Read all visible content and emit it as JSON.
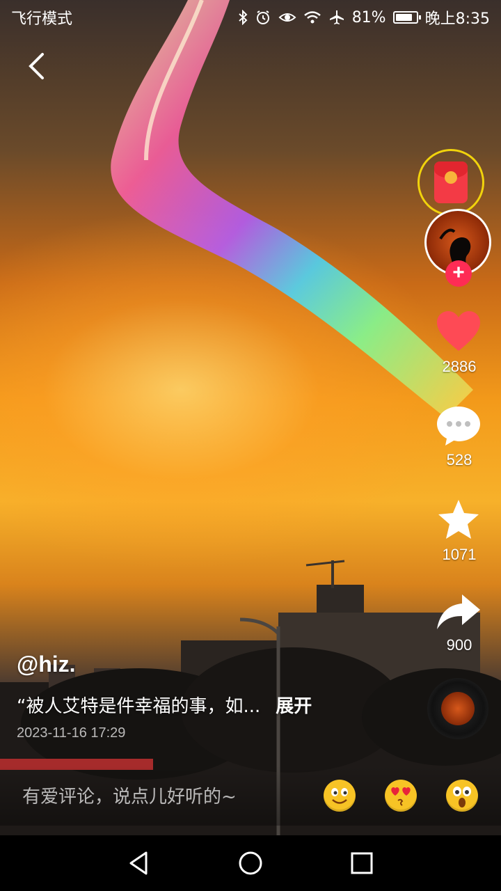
{
  "status_bar": {
    "mode": "飞行模式",
    "battery_percent": "81%",
    "battery_level": 0.81,
    "time": "晚上8:35",
    "icons": [
      "bluetooth-icon",
      "alarm-icon",
      "eye-icon",
      "wifi-icon",
      "airplane-icon",
      "battery-icon"
    ]
  },
  "video": {
    "author": "@hiz.",
    "caption": "“被人艾特是件幸福的事，如...",
    "expand_label": "展开",
    "timestamp": "2023-11-16 17:29"
  },
  "actions": {
    "likes": "2886",
    "comments": "528",
    "favorites": "1071",
    "shares": "900"
  },
  "comment_input": {
    "placeholder": "有爱评论，说点儿好听的~",
    "emojis": [
      "smile-emoji",
      "heart-eyes-emoji",
      "surprised-emoji"
    ]
  },
  "colors": {
    "like_red": "#fe4a55",
    "redpack_ring": "#f1d30c",
    "follow_plus": "#fe2c55"
  }
}
